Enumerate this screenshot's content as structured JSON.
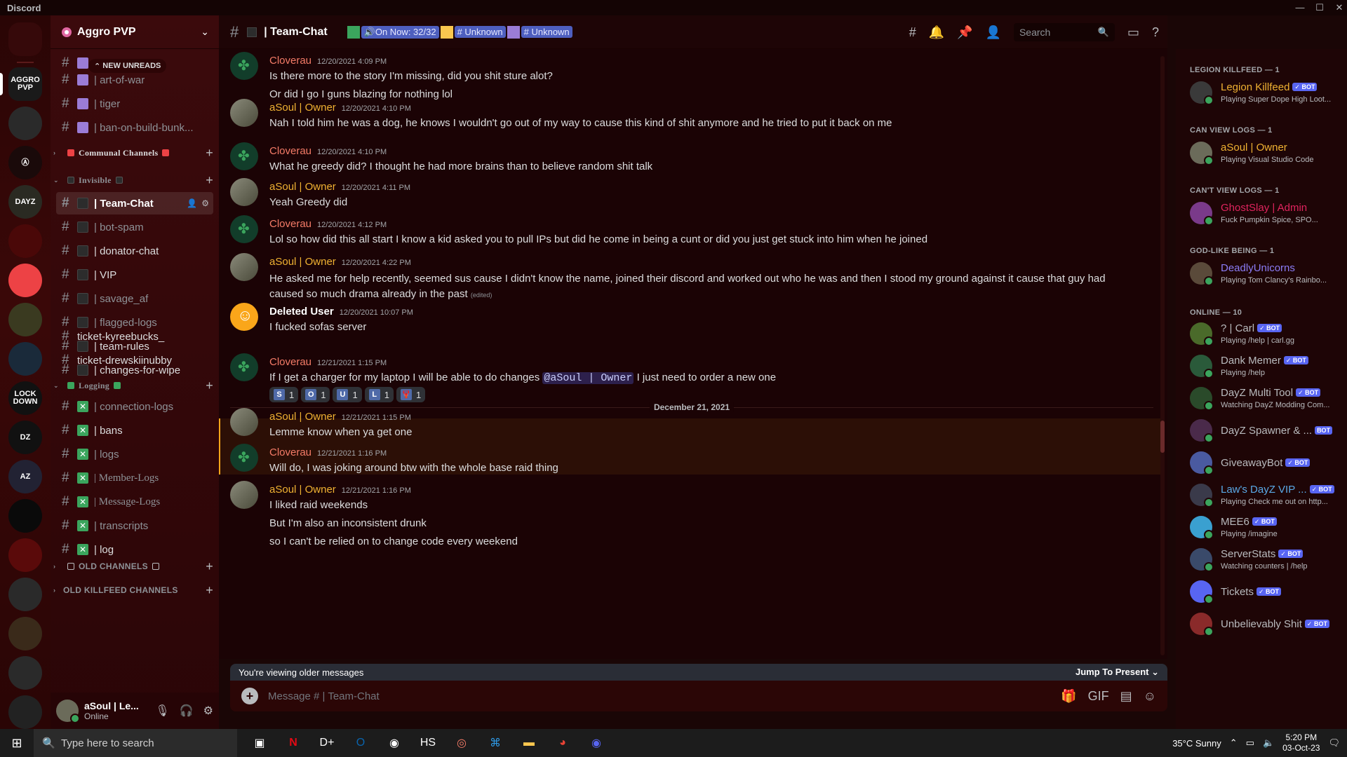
{
  "window": {
    "title": "Discord"
  },
  "rail": {
    "servers": [
      {
        "label": "",
        "name": "home"
      },
      {
        "label": "AGGRO PVP",
        "name": "aggro-pvp"
      },
      {
        "label": "",
        "name": "skull"
      },
      {
        "label": "Ⓐ",
        "name": "anarchy"
      },
      {
        "label": "DAYZ",
        "name": "dayz-multitool"
      },
      {
        "label": "",
        "name": "red-skull"
      },
      {
        "label": "",
        "name": "red-folder"
      },
      {
        "label": "",
        "name": "helmet"
      },
      {
        "label": "",
        "name": "globe"
      },
      {
        "label": "LOCK DOWN",
        "name": "lockdown"
      },
      {
        "label": "DZ",
        "name": "dz"
      },
      {
        "label": "AZ",
        "name": "az"
      },
      {
        "label": "",
        "name": "black-server"
      },
      {
        "label": "",
        "name": "revolution"
      },
      {
        "label": "",
        "name": "soldier"
      },
      {
        "label": "",
        "name": "the-day-after"
      },
      {
        "label": "",
        "name": "server-17"
      },
      {
        "label": "",
        "name": "server-18"
      }
    ]
  },
  "sidebar": {
    "server_name": "Aggro PVP",
    "new_unreads": "NEW UNREADS",
    "channels": [
      {
        "label": "| art-of-war",
        "sq": "purple",
        "bright": false
      },
      {
        "label": "| tiger",
        "sq": "purple",
        "bright": false
      },
      {
        "label": "| ban-on-build-bunk...",
        "sq": "purple",
        "bright": false
      }
    ],
    "categories": {
      "communal": "Communal Channels",
      "invisible": "Invisible",
      "logging": "Logging",
      "old_channels": "OLD CHANNELS",
      "old_killfeed": "OLD KILLFEED CHANNELS"
    },
    "invisible_channels": [
      {
        "label": "| Team-Chat",
        "active": true
      },
      {
        "label": "| bot-spam"
      },
      {
        "label": "| donator-chat",
        "bright": true
      },
      {
        "label": "| VIP",
        "bright": true
      },
      {
        "label": "| savage_af"
      },
      {
        "label": "| flagged-logs"
      },
      {
        "label": "| team-rules",
        "bright": true
      },
      {
        "label": "| changes-for-wipe",
        "bright": true
      }
    ],
    "tickets": [
      "ticket-kyreebucks_",
      "ticket-drewskiinubby"
    ],
    "logging_channels": [
      {
        "label": "| connection-logs"
      },
      {
        "label": "| bans",
        "bright": true
      },
      {
        "label": "| logs"
      },
      {
        "label": "| Member-Logs"
      },
      {
        "label": "| Message-Logs"
      },
      {
        "label": "| transcripts"
      },
      {
        "label": "| log",
        "bright": true
      }
    ],
    "user": {
      "name": "aSoul | Le...",
      "status": "Online"
    }
  },
  "header": {
    "channel_name": "| Team-Chat",
    "topic_on_now": "🔊On Now: 32/32",
    "topic_unknown_1": "# Unknown",
    "topic_unknown_2": "# Unknown",
    "search_placeholder": "Search"
  },
  "messages": [
    {
      "author": "Cloverau",
      "type": "clover",
      "ts": "12/20/2021 4:09 PM",
      "lines": [
        "Is there more to the story I'm missing, did you shit sture alot?",
        "Or did I go I guns blazing for nothing lol"
      ]
    },
    {
      "author": "aSoul | Owner",
      "type": "asoul",
      "ts": "12/20/2021 4:10 PM",
      "lines": [
        "Nah I told him he was a dog, he knows I wouldn't go out of my way to cause this kind of shit anymore and he tried to put it back on me"
      ]
    },
    {
      "author": "Cloverau",
      "type": "clover",
      "ts": "12/20/2021 4:10 PM",
      "lines": [
        "What he greedy did? I thought he had more brains than to believe random shit talk"
      ]
    },
    {
      "author": "aSoul | Owner",
      "type": "asoul",
      "ts": "12/20/2021 4:11 PM",
      "lines": [
        "Yeah Greedy did"
      ]
    },
    {
      "author": "Cloverau",
      "type": "clover",
      "ts": "12/20/2021 4:12 PM",
      "lines": [
        "Lol so how did this all start I know a kid asked you to pull IPs but did he come in being a cunt or did you just get stuck into him when he joined"
      ]
    },
    {
      "author": "aSoul | Owner",
      "type": "asoul",
      "ts": "12/20/2021 4:22 PM",
      "lines": [
        "He asked me for help recently, seemed sus cause I didn't know the name, joined their discord and worked out who he was and then I stood my ground against it cause that guy had caused so much drama already in the past"
      ],
      "edited": "(edited)"
    },
    {
      "author": "Deleted User",
      "type": "deleted",
      "ts": "12/20/2021 10:07 PM",
      "lines": [
        "I fucked sofas server"
      ]
    },
    {
      "author": "Cloverau",
      "type": "clover",
      "ts": "12/21/2021 1:15 PM",
      "lines": [
        "If I get a charger for my laptop I will be able to do changes"
      ],
      "mention": "@aSoul | Owner",
      "after_mention": "I just need to order a new one"
    },
    {
      "author": "aSoul | Owner",
      "type": "asoul",
      "ts": "12/21/2021 1:15 PM",
      "lines": [
        "Lemme know when ya get one"
      ]
    },
    {
      "author": "Cloverau",
      "type": "clover",
      "ts": "12/21/2021 1:16 PM",
      "lines": [
        "Will do, I was joking around btw with the whole base raid thing"
      ]
    },
    {
      "author": "aSoul | Owner",
      "type": "asoul",
      "ts": "12/21/2021 1:16 PM",
      "lines": [
        "I liked raid weekends",
        "But I'm also an inconsistent drunk",
        "so I can't be relied on to change code every weekend"
      ]
    }
  ],
  "date_divider": "December 21, 2021",
  "reactions": [
    {
      "letter": "S",
      "count": "1"
    },
    {
      "letter": "O",
      "count": "1"
    },
    {
      "letter": "U",
      "count": "1"
    },
    {
      "letter": "L",
      "count": "1"
    },
    {
      "letter": "🦞",
      "count": "1"
    }
  ],
  "older_bar": {
    "text": "You're viewing older messages",
    "jump": "Jump To Present"
  },
  "composer": {
    "placeholder": "Message #  | Team-Chat"
  },
  "members": {
    "categories": [
      "LEGION KILLFEED — 1",
      "CAN VIEW LOGS — 1",
      "CAN'T VIEW LOGS — 1",
      "GOD-LIKE BEING — 1",
      "ONLINE — 10"
    ],
    "list": [
      {
        "name": "Legion Killfeed",
        "color": "#f0b232",
        "bot": "✓ BOT",
        "activity": "Playing Super Dope High Loot..."
      },
      {
        "name": "aSoul | Owner",
        "color": "#f0b232",
        "bot": "",
        "activity": "Playing Visual Studio Code"
      },
      {
        "name": "GhostSlay | Admin",
        "color": "#e0245e",
        "bot": "",
        "activity": "Fuck Pumpkin Spice, SPO..."
      },
      {
        "name": "DeadlyUnicorns",
        "color": "#8b7cf6",
        "bot": "",
        "activity": "Playing Tom Clancy's Rainbo..."
      },
      {
        "name": "? | Carl",
        "color": "#b9bbbe",
        "bot": "✓ BOT",
        "activity": "Playing /help | carl.gg"
      },
      {
        "name": "Dank Memer",
        "color": "#b9bbbe",
        "bot": "✓ BOT",
        "activity": "Playing /help"
      },
      {
        "name": "DayZ Multi Tool",
        "color": "#b9bbbe",
        "bot": "✓ BOT",
        "activity": "Watching DayZ Modding Com..."
      },
      {
        "name": "DayZ Spawner & ...",
        "color": "#b9bbbe",
        "bot": "BOT",
        "activity": ""
      },
      {
        "name": "GiveawayBot",
        "color": "#b9bbbe",
        "bot": "✓ BOT",
        "activity": ""
      },
      {
        "name": "Law's DayZ VIP ...",
        "color": "#5aa9e6",
        "bot": "✓ BOT",
        "activity": "Playing Check me out on http..."
      },
      {
        "name": "MEE6",
        "color": "#b9bbbe",
        "bot": "✓ BOT",
        "activity": "Playing /imagine"
      },
      {
        "name": "ServerStats",
        "color": "#b9bbbe",
        "bot": "✓ BOT",
        "activity": "Watching counters | /help"
      },
      {
        "name": "Tickets",
        "color": "#b9bbbe",
        "bot": "✓ BOT",
        "activity": ""
      },
      {
        "name": "Unbelievably Shit",
        "color": "#b9bbbe",
        "bot": "✓ BOT",
        "activity": ""
      }
    ]
  },
  "taskbar": {
    "search_placeholder": "Type here to search",
    "weather": "35°C  Sunny",
    "time": "5:20 PM",
    "date": "03-Oct-23"
  }
}
